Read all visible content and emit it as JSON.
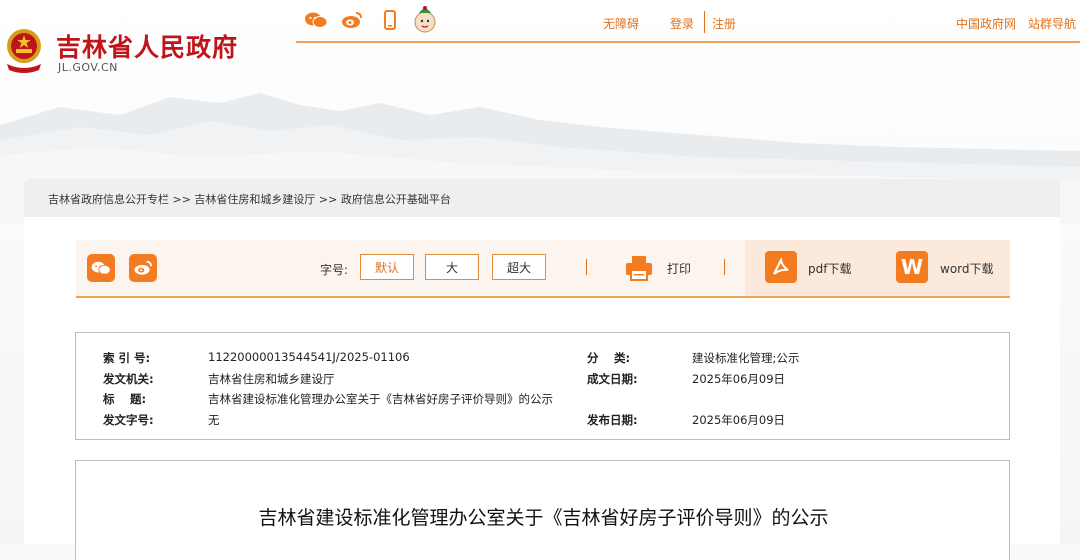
{
  "header": {
    "site_name": "吉林省人民政府",
    "site_domain": "JL.GOV.CN",
    "nav": {
      "accessibility": "无障碍",
      "login": "登录",
      "register": "注册",
      "china_gov": "中国政府网",
      "site_group_nav": "站群导航"
    },
    "share_icons": [
      "wechat-icon",
      "weibo-icon",
      "mobile-icon",
      "mascot-icon"
    ]
  },
  "breadcrumb": "吉林省政府信息公开专栏 >> 吉林省住房和城乡建设厅 >> 政府信息公开基础平台",
  "toolbar": {
    "font_label": "字号:",
    "font_default": "默认",
    "font_large": "大",
    "font_xlarge": "超大",
    "print": "打印",
    "pdf_download": "pdf下载",
    "word_download": "word下载",
    "word_icon_letter": "W"
  },
  "meta": {
    "index_label": "索 引 号:",
    "index_value": "11220000013544541J/2025-01106",
    "category_label": "分　 类:",
    "category_value": "建设标准化管理;公示",
    "issuer_label": "发文机关:",
    "issuer_value": "吉林省住房和城乡建设厅",
    "date_written_label": "成文日期:",
    "date_written_value": "2025年06月09日",
    "title_label": "标　 题:",
    "title_value": "吉林省建设标准化管理办公室关于《吉林省好房子评价导则》的公示",
    "doc_no_label": "发文字号:",
    "doc_no_value": "无",
    "publish_date_label": "发布日期:",
    "publish_date_value": "2025年06月09日"
  },
  "article": {
    "title": "吉林省建设标准化管理办公室关于《吉林省好房子评价导则》的公示"
  },
  "colors": {
    "brand_red": "#c0141b",
    "accent_orange": "#f47b20",
    "link_orange": "#e0721f"
  }
}
